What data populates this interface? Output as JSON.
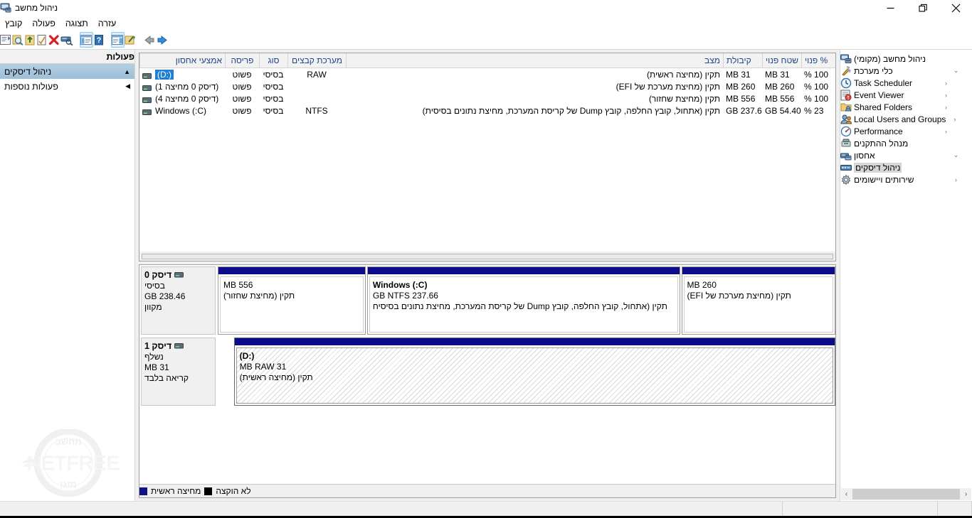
{
  "window": {
    "title": "ניהול מחשב",
    "icon": "computer-management-icon",
    "controls": {
      "close": "✕",
      "restore": "❐",
      "minimize": "─"
    }
  },
  "menu": {
    "items": [
      "קובץ",
      "פעולה",
      "תצוגה",
      "עזרה"
    ]
  },
  "toolbar": {
    "buttons": [
      {
        "name": "properties-icon",
        "glyph": "▤"
      },
      {
        "name": "search-icon",
        "glyph": "🔍"
      },
      {
        "name": "export-list-icon",
        "glyph": "⬆"
      },
      {
        "name": "checklist-icon",
        "glyph": "☑"
      },
      {
        "name": "delete-icon",
        "glyph": "✖"
      },
      {
        "name": "rescan-disks-icon",
        "glyph": "🖴"
      },
      {
        "name": "show-action-pane-icon",
        "glyph": "▥",
        "selected": true
      },
      {
        "name": "help-icon",
        "glyph": "?"
      },
      {
        "name": "show-tree-pane-icon",
        "glyph": "▤",
        "selected": true
      },
      {
        "name": "new-window-icon",
        "glyph": "🗂"
      },
      {
        "name": "back-icon",
        "glyph": "⬅"
      },
      {
        "name": "forward-icon",
        "glyph": "➡"
      }
    ]
  },
  "tree": {
    "items": [
      {
        "label": "ניהול מחשב (מקומי)",
        "icon": "computer-icon",
        "indent": 0,
        "twist": "",
        "selected": false
      },
      {
        "label": "כלי מערכת",
        "icon": "tools-icon",
        "indent": 1,
        "twist": "⌄",
        "selected": false
      },
      {
        "label": "Task Scheduler",
        "icon": "clock-icon",
        "indent": 2,
        "twist": "‹",
        "selected": false
      },
      {
        "label": "Event Viewer",
        "icon": "event-log-icon",
        "indent": 2,
        "twist": "‹",
        "selected": false
      },
      {
        "label": "Shared Folders",
        "icon": "shared-folder-icon",
        "indent": 2,
        "twist": "‹",
        "selected": false
      },
      {
        "label": "Local Users and Groups",
        "icon": "users-icon",
        "indent": 2,
        "twist": "‹",
        "selected": false
      },
      {
        "label": "Performance",
        "icon": "performance-icon",
        "indent": 2,
        "twist": "‹",
        "selected": false
      },
      {
        "label": "מנהל ההתקנים",
        "icon": "device-manager-icon",
        "indent": 2,
        "twist": "",
        "selected": false
      },
      {
        "label": "אחסון",
        "icon": "storage-icon",
        "indent": 1,
        "twist": "⌄",
        "selected": false
      },
      {
        "label": "ניהול דיסקים",
        "icon": "disk-management-icon",
        "indent": 2,
        "twist": "",
        "selected": true
      },
      {
        "label": "שירותים ויישומים",
        "icon": "services-icon",
        "indent": 1,
        "twist": "‹",
        "selected": false
      }
    ],
    "scrollbar": {
      "left_arrow": "‹",
      "right_arrow": "›"
    }
  },
  "actions": {
    "header": "פעולות",
    "items": [
      {
        "label": "ניהול דיסקים",
        "caret": "▲",
        "selected": true
      },
      {
        "label": "פעולות נוספות",
        "caret": "◀",
        "selected": false
      }
    ]
  },
  "volumes": {
    "columns": [
      "אמצעי אחסון",
      "פריסה",
      "סוג",
      "מערכת קבצים",
      "מצב",
      "קיבולת",
      "שטח פנוי",
      "% פנוי"
    ],
    "rows": [
      {
        "volume": "(:D)",
        "selected": true,
        "layout": "פשוט",
        "type": "בסיסי",
        "fs": "RAW",
        "status": "תקין (מחיצה ראשית)",
        "capacity": "31 MB",
        "free": "31 MB",
        "pct": "100 %"
      },
      {
        "volume": "(דיסק 0 מחיצה 1)",
        "selected": false,
        "layout": "פשוט",
        "type": "בסיסי",
        "fs": "",
        "status": "תקין (מחיצת מערכת של EFI)",
        "capacity": "260 MB",
        "free": "260 MB",
        "pct": "100 %"
      },
      {
        "volume": "(דיסק 0 מחיצה 4)",
        "selected": false,
        "layout": "פשוט",
        "type": "בסיסי",
        "fs": "",
        "status": "תקין (מחיצת שחזור)",
        "capacity": "556 MB",
        "free": "556 MB",
        "pct": "100 %"
      },
      {
        "volume": "Windows (:C)",
        "selected": false,
        "layout": "פשוט",
        "type": "בסיסי",
        "fs": "NTFS",
        "status": "תקין (אתחול, קובץ החלפה, קובץ Dump של קריסת המערכת, מחיצת נתונים בסיסית)",
        "capacity": "237.66 GB",
        "free": "54.40 GB",
        "pct": "23 %"
      }
    ]
  },
  "disks": [
    {
      "name": "דיסק 0",
      "type": "בסיסי",
      "size": "238.46 GB",
      "state": "מקוון",
      "partitions": [
        {
          "width_pct": 24,
          "title": "",
          "size": "556 MB",
          "status": "תקין (מחיצת שחזור)",
          "hatched": false,
          "selected": false
        },
        {
          "width_pct": 51,
          "title": "Windows  (:C)",
          "size": "237.66 GB NTFS",
          "status": "תקין (אתחול, קובץ החלפה, קובץ Dump של קריסת המערכת, מחיצת נתונים בסיסיח",
          "hatched": false,
          "selected": false
        },
        {
          "width_pct": 25,
          "title": "",
          "size": "260 MB",
          "status": "תקין (מחיצת מערכת של EFI)",
          "hatched": false,
          "selected": false
        }
      ]
    },
    {
      "name": "דיסק 1",
      "type": "נשלף",
      "size": "31 MB",
      "state": "קריאה בלבד",
      "partitions": [
        {
          "width_pct": 100,
          "title": "(:D)",
          "size": "31 MB RAW",
          "status": "תקין (מחיצה ראשית)",
          "hatched": true,
          "selected": true
        }
      ]
    }
  ],
  "legend": {
    "entries": [
      {
        "label": "מחיצה ראשית",
        "color": "#111188"
      },
      {
        "label": "לא הוקצה",
        "color": "#000000"
      }
    ]
  },
  "statusbar": {
    "segments": [
      "",
      "",
      "",
      ""
    ]
  },
  "watermark": {
    "top": "מחשב",
    "main": "NETFREE",
    "bottom": "מוגן"
  },
  "colors": {
    "partition_bar": "#0b0b8c",
    "selection_blue": "#1e7fd4",
    "header_text": "#20478b",
    "action_selected": "#9dbfd8"
  }
}
